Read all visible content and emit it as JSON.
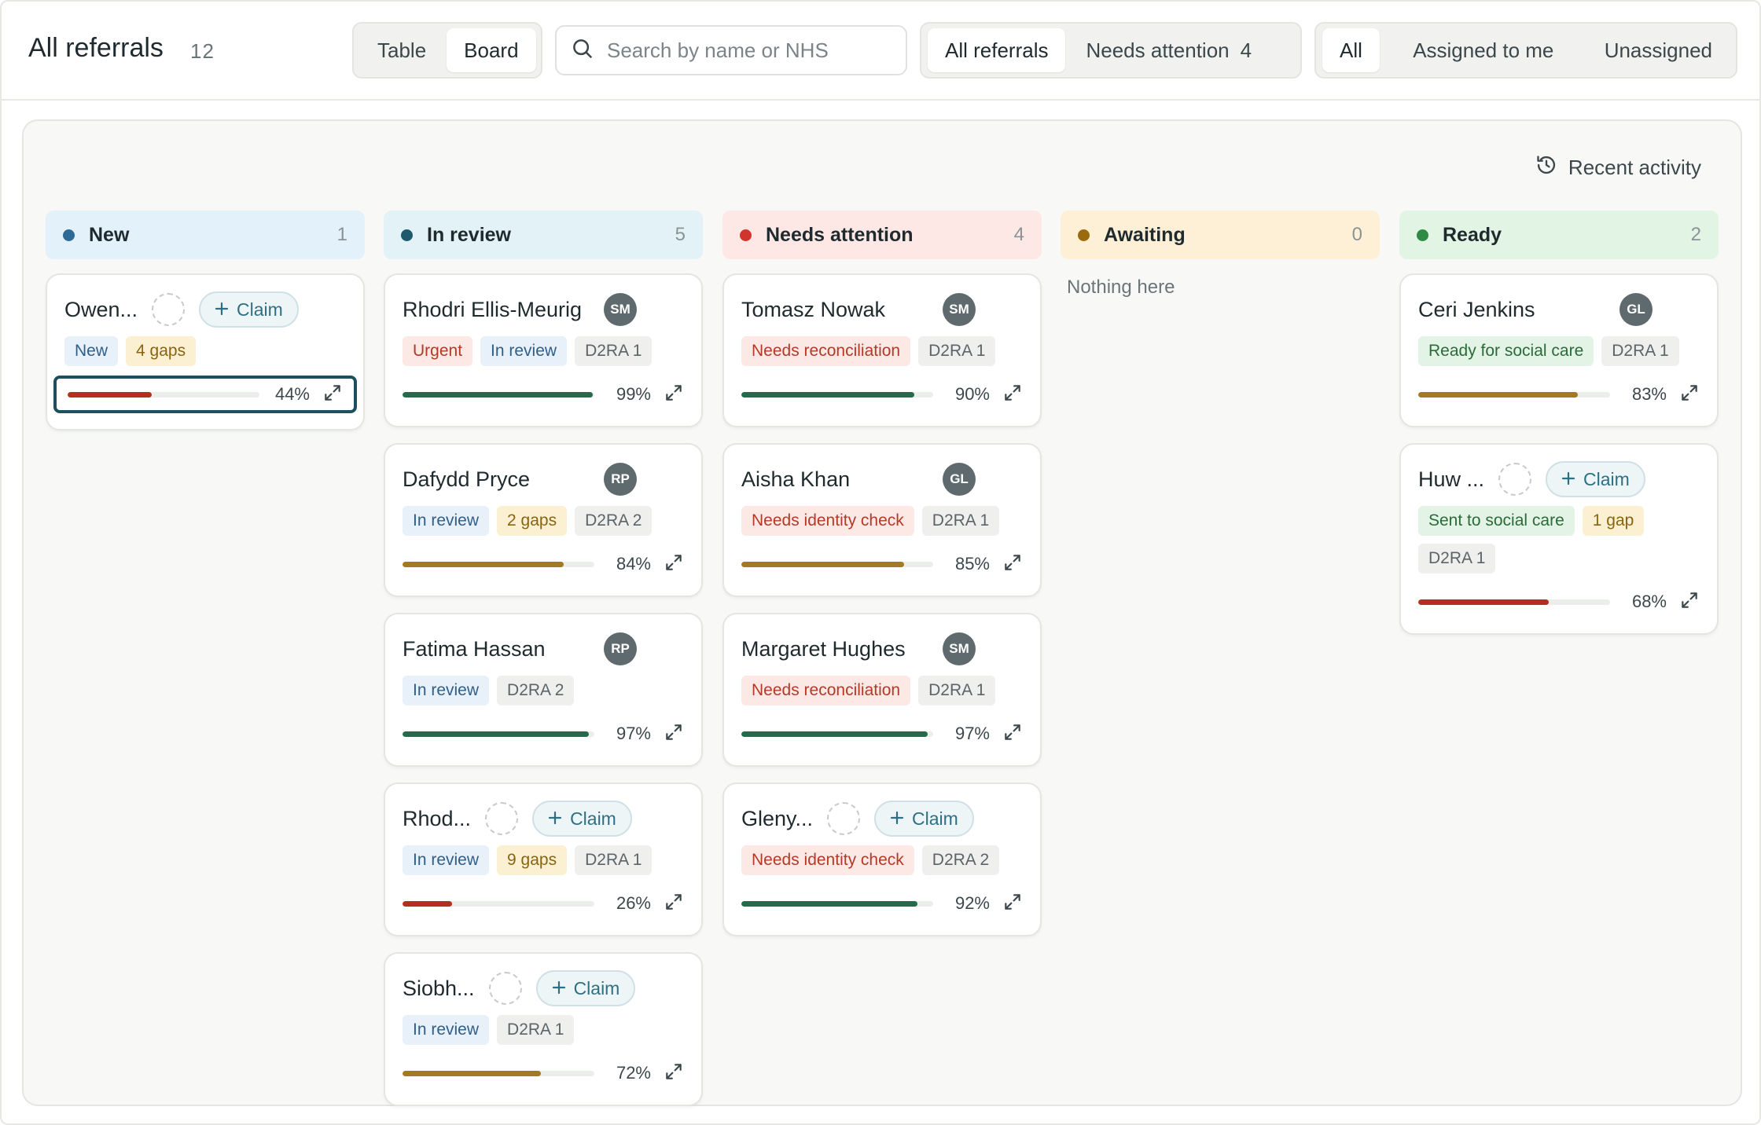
{
  "header": {
    "title": "All referrals",
    "count": "12",
    "view_toggle": [
      {
        "label": "Table",
        "active": false
      },
      {
        "label": "Board",
        "active": true
      }
    ],
    "search": {
      "placeholder": "Search by name or NHS",
      "value": "",
      "icon": "search-icon"
    },
    "filter_tabs": [
      {
        "label": "All referrals",
        "count": "",
        "active": true
      },
      {
        "label": "Needs attention",
        "count": "4",
        "active": false
      }
    ],
    "assign_tabs": [
      {
        "label": "All",
        "active": true
      },
      {
        "label": "Assigned to me",
        "active": false
      },
      {
        "label": "Unassigned",
        "active": false
      }
    ]
  },
  "board": {
    "activity_label": "Recent activity",
    "activity_icon": "history-icon",
    "empty_text": "Nothing here",
    "claim_label": "Claim",
    "colors": {
      "red": "#b5301c",
      "green": "#236b4b",
      "amber": "#a27a24"
    },
    "columns": [
      {
        "key": "new",
        "label": "New",
        "count": "1",
        "dot": "#2d6a95",
        "bg": "#e3f1fb",
        "cards": [
          {
            "name": "Owen...",
            "avatar": "",
            "claim": true,
            "tags": [
              {
                "text": "New",
                "color": "blue"
              },
              {
                "text": "4 gaps",
                "color": "amber"
              }
            ],
            "progress": 44,
            "bar": "red",
            "focus": true
          }
        ]
      },
      {
        "key": "review",
        "label": "In review",
        "count": "5",
        "dot": "#1e5a6b",
        "bg": "#e2f2f6",
        "cards": [
          {
            "name": "Rhodri Ellis-Meurig",
            "avatar": "SM",
            "claim": false,
            "tags": [
              {
                "text": "Urgent",
                "color": "red"
              },
              {
                "text": "In review",
                "color": "blue"
              },
              {
                "text": "D2RA 1",
                "color": "gray"
              }
            ],
            "progress": 99,
            "bar": "green"
          },
          {
            "name": "Dafydd Pryce",
            "avatar": "RP",
            "claim": false,
            "tags": [
              {
                "text": "In review",
                "color": "blue"
              },
              {
                "text": "2 gaps",
                "color": "amber"
              },
              {
                "text": "D2RA 2",
                "color": "gray"
              }
            ],
            "progress": 84,
            "bar": "amber"
          },
          {
            "name": "Fatima Hassan",
            "avatar": "RP",
            "claim": false,
            "tags": [
              {
                "text": "In review",
                "color": "blue"
              },
              {
                "text": "D2RA 2",
                "color": "gray"
              }
            ],
            "progress": 97,
            "bar": "green"
          },
          {
            "name": "Rhod...",
            "avatar": "",
            "claim": true,
            "tags": [
              {
                "text": "In review",
                "color": "blue"
              },
              {
                "text": "9 gaps",
                "color": "amber"
              },
              {
                "text": "D2RA 1",
                "color": "gray"
              }
            ],
            "progress": 26,
            "bar": "red"
          },
          {
            "name": "Siobh...",
            "avatar": "",
            "claim": true,
            "tags": [
              {
                "text": "In review",
                "color": "blue"
              },
              {
                "text": "D2RA 1",
                "color": "gray"
              }
            ],
            "progress": 72,
            "bar": "amber"
          }
        ]
      },
      {
        "key": "attention",
        "label": "Needs attention",
        "count": "4",
        "dot": "#d0342c",
        "bg": "#fde8e6",
        "cards": [
          {
            "name": "Tomasz Nowak",
            "avatar": "SM",
            "claim": false,
            "tags": [
              {
                "text": "Needs reconciliation",
                "color": "red"
              },
              {
                "text": "D2RA 1",
                "color": "gray"
              }
            ],
            "progress": 90,
            "bar": "green"
          },
          {
            "name": "Aisha Khan",
            "avatar": "GL",
            "claim": false,
            "tags": [
              {
                "text": "Needs identity check",
                "color": "red"
              },
              {
                "text": "D2RA 1",
                "color": "gray"
              }
            ],
            "progress": 85,
            "bar": "amber"
          },
          {
            "name": "Margaret Hughes",
            "avatar": "SM",
            "claim": false,
            "tags": [
              {
                "text": "Needs reconciliation",
                "color": "red"
              },
              {
                "text": "D2RA 1",
                "color": "gray"
              }
            ],
            "progress": 97,
            "bar": "green"
          },
          {
            "name": "Gleny...",
            "avatar": "",
            "claim": true,
            "tags": [
              {
                "text": "Needs identity check",
                "color": "red"
              },
              {
                "text": "D2RA 2",
                "color": "gray"
              }
            ],
            "progress": 92,
            "bar": "green"
          }
        ]
      },
      {
        "key": "awaiting",
        "label": "Awaiting",
        "count": "0",
        "dot": "#9a6a0e",
        "bg": "#fdf0d6",
        "cards": []
      },
      {
        "key": "ready",
        "label": "Ready",
        "count": "2",
        "dot": "#2e8a45",
        "bg": "#e2f4e4",
        "cards": [
          {
            "name": "Ceri Jenkins",
            "avatar": "GL",
            "claim": false,
            "tags": [
              {
                "text": "Ready for social care",
                "color": "green"
              },
              {
                "text": "D2RA 1",
                "color": "gray"
              }
            ],
            "progress": 83,
            "bar": "amber"
          },
          {
            "name": "Huw ...",
            "avatar": "",
            "claim": true,
            "tags": [
              {
                "text": "Sent to social care",
                "color": "green"
              },
              {
                "text": "1 gap",
                "color": "amber"
              },
              {
                "text": "D2RA 1",
                "color": "gray"
              }
            ],
            "progress": 68,
            "bar": "red"
          }
        ]
      }
    ]
  }
}
